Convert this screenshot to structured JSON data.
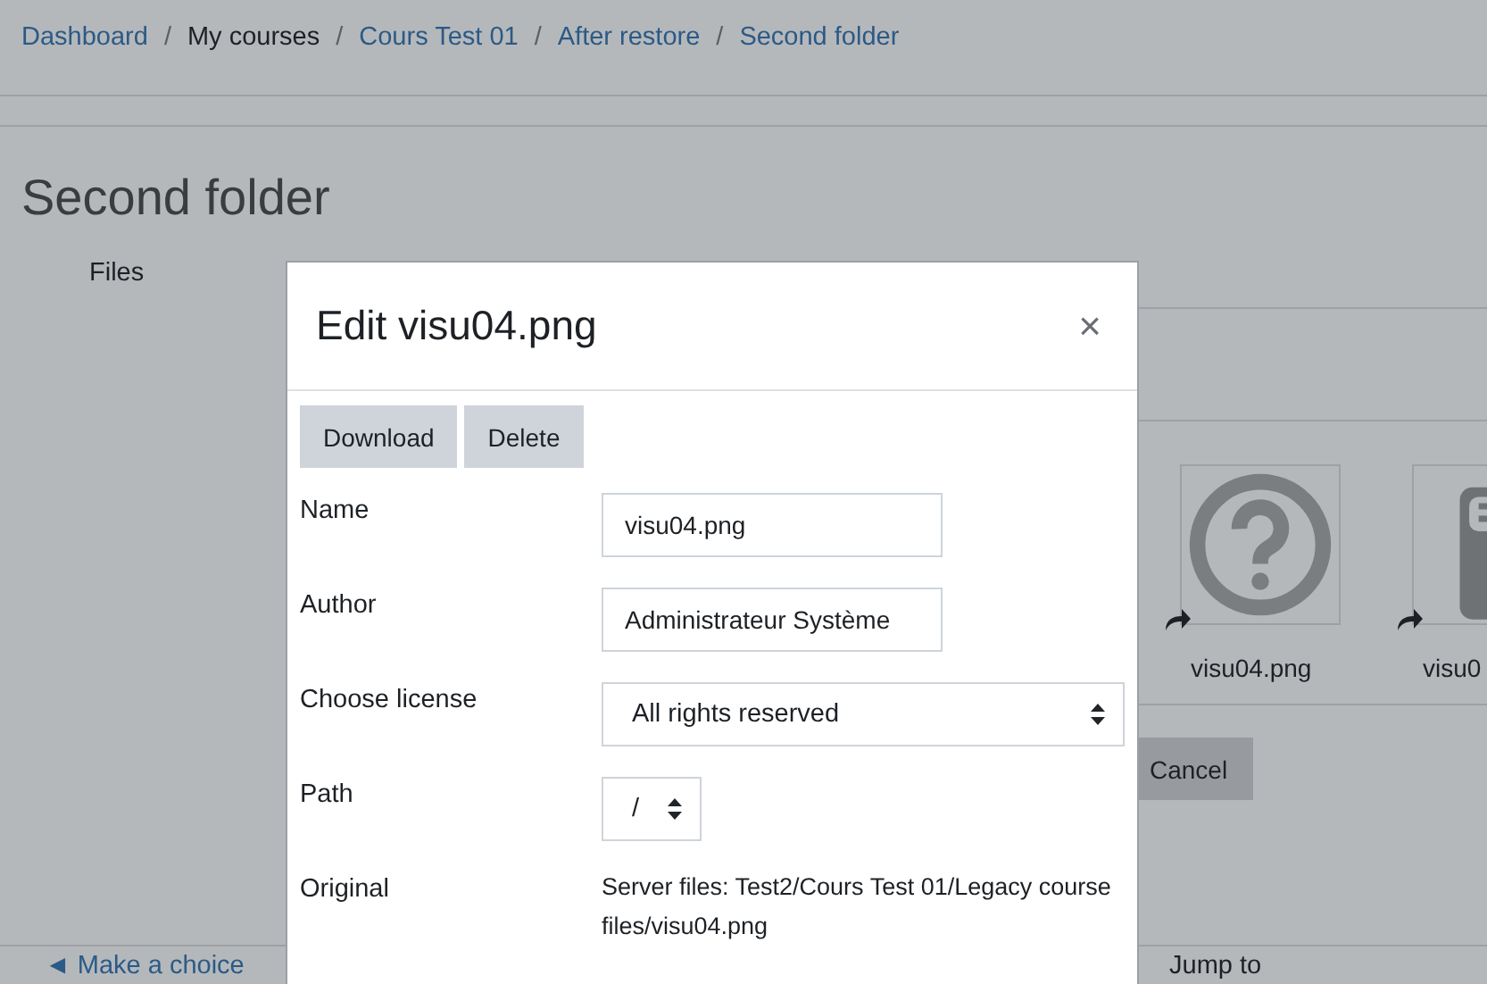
{
  "breadcrumb": [
    {
      "label": "Dashboard",
      "kind": "link"
    },
    {
      "label": "My courses",
      "kind": "text"
    },
    {
      "label": "Cours Test 01",
      "kind": "link"
    },
    {
      "label": "After restore",
      "kind": "link"
    },
    {
      "label": "Second folder",
      "kind": "link"
    }
  ],
  "breadcrumb_separator": "/",
  "page_title": "Second folder",
  "files_label": "Files",
  "files": [
    {
      "name": "visu04.png",
      "kind": "unknown"
    },
    {
      "name": "visu0",
      "kind": "document"
    }
  ],
  "cancel_button": "Cancel",
  "footer": {
    "prev_link": "◄ Make a choice",
    "jump_label": "Jump to"
  },
  "modal": {
    "title": "Edit visu04.png",
    "close": "×",
    "actions": [
      "Download",
      "Delete"
    ],
    "fields": [
      {
        "label": "Name",
        "kind": "input",
        "value": "visu04.png"
      },
      {
        "label": "Author",
        "kind": "input",
        "value": "Administrateur Système"
      },
      {
        "label": "Choose license",
        "kind": "select",
        "value": "All rights reserved"
      },
      {
        "label": "Path",
        "kind": "select_small",
        "value": "/"
      },
      {
        "label": "Original",
        "kind": "text",
        "value": "Server files: Test2/Cours Test 01/Legacy course files/visu04.png"
      }
    ]
  }
}
